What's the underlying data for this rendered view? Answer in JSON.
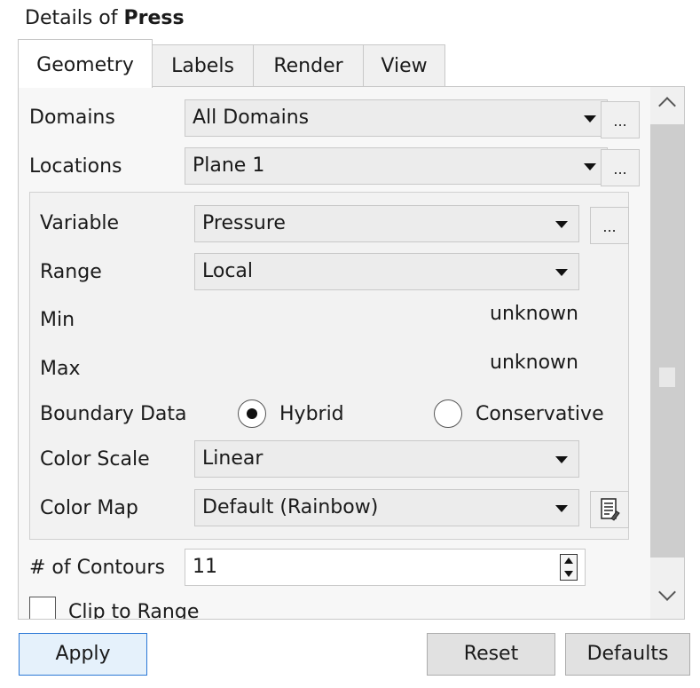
{
  "header": {
    "prefix": "Details of ",
    "object": "Press"
  },
  "tabs": [
    {
      "label": "Geometry",
      "active": true
    },
    {
      "label": "Labels"
    },
    {
      "label": "Render"
    },
    {
      "label": "View"
    }
  ],
  "fields": {
    "domains": {
      "label": "Domains",
      "value": "All Domains",
      "more": "..."
    },
    "locations": {
      "label": "Locations",
      "value": "Plane 1",
      "more": "..."
    },
    "variable": {
      "label": "Variable",
      "value": "Pressure",
      "more": "..."
    },
    "range": {
      "label": "Range",
      "value": "Local"
    },
    "min": {
      "label": "Min",
      "value": "unknown"
    },
    "max": {
      "label": "Max",
      "value": "unknown"
    },
    "boundary": {
      "label": "Boundary Data",
      "options": [
        {
          "label": "Hybrid",
          "selected": true
        },
        {
          "label": "Conservative",
          "selected": false
        }
      ]
    },
    "color_scale": {
      "label": "Color Scale",
      "value": "Linear"
    },
    "color_map": {
      "label": "Color Map",
      "value": "Default (Rainbow)"
    },
    "contours": {
      "label": "# of Contours",
      "value": "11"
    },
    "clip": {
      "label": "Clip to Range",
      "checked": false
    }
  },
  "buttons": {
    "apply": "Apply",
    "reset": "Reset",
    "defaults": "Defaults"
  },
  "colors": {
    "apply_border": "#2b78d6",
    "apply_bg": "#e5f1fb"
  }
}
